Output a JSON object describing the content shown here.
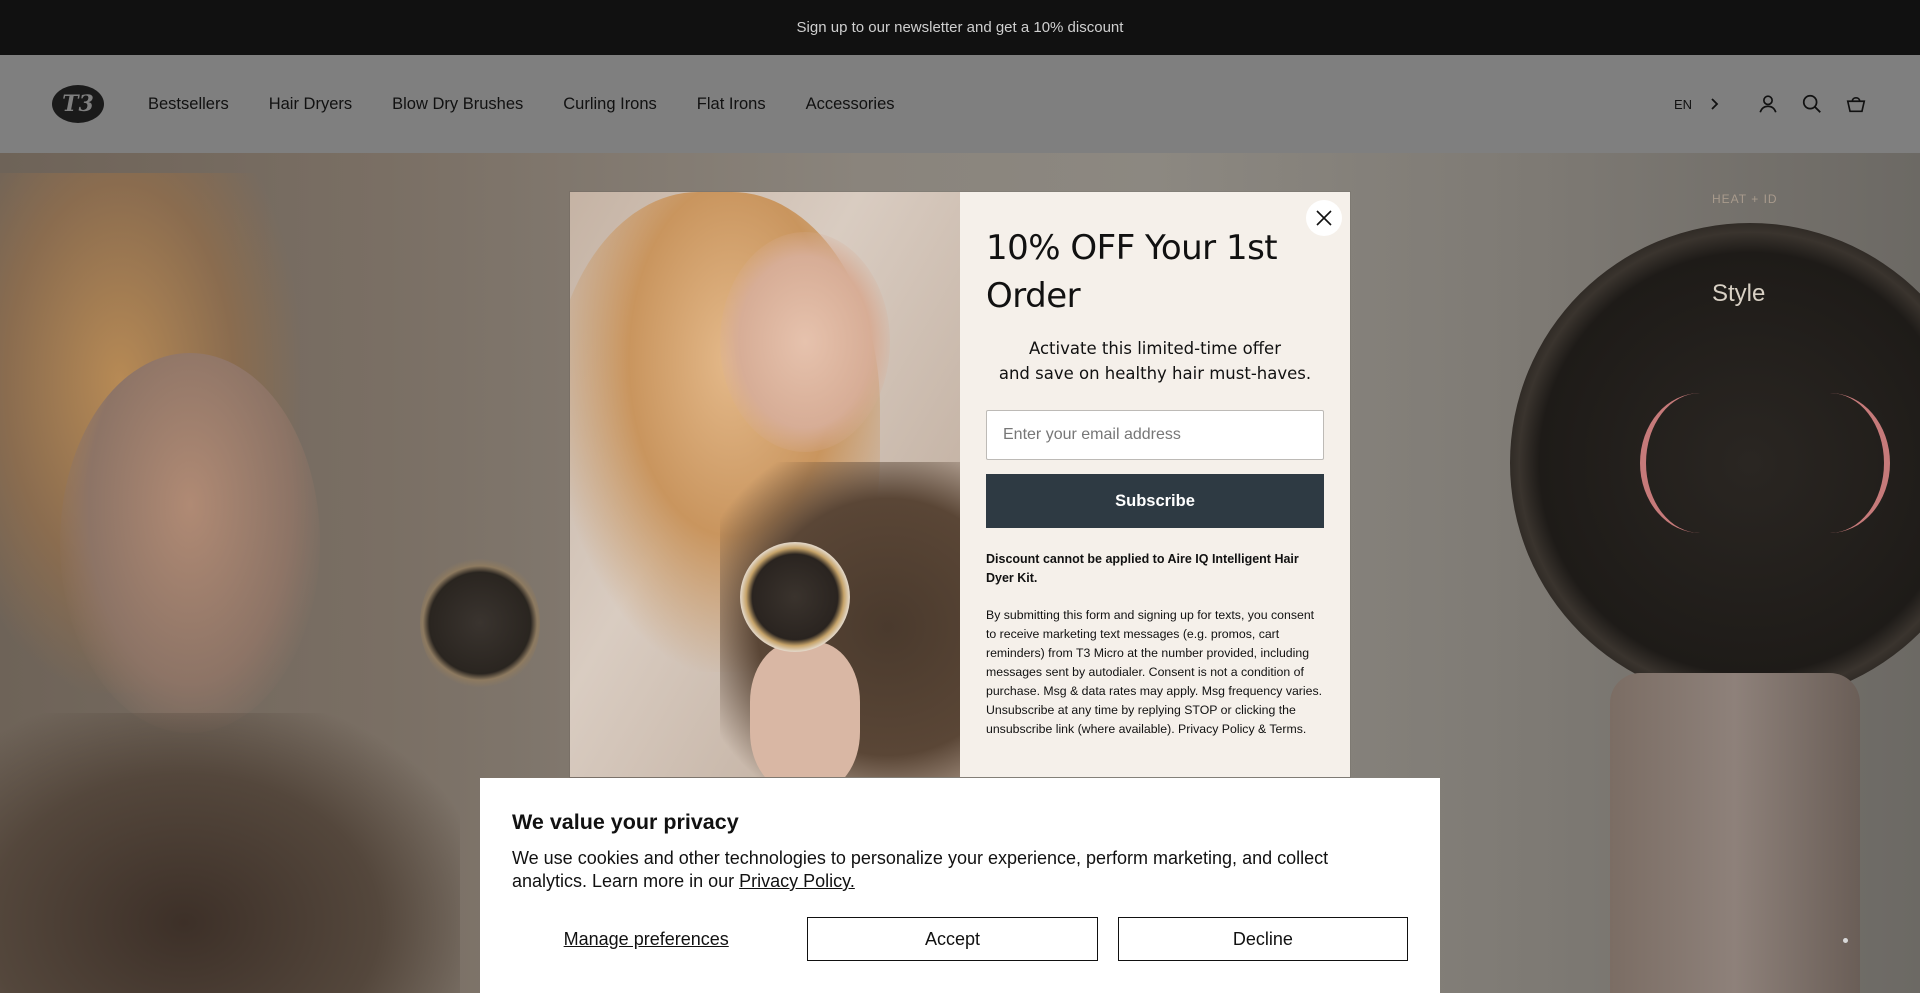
{
  "announcement": "Sign up to our newsletter and get a 10% discount",
  "header": {
    "logo": "T3",
    "nav": [
      "Bestsellers",
      "Hair Dryers",
      "Blow Dry Brushes",
      "Curling Irons",
      "Flat Irons",
      "Accessories"
    ],
    "language": "EN",
    "icons": [
      "chevron-right-icon",
      "account-icon",
      "search-icon",
      "cart-icon"
    ]
  },
  "hero": {
    "dial_label": "Style",
    "dial_top_label": "HEAT + ID"
  },
  "popup": {
    "title": "10% OFF Your 1st Order",
    "subtitle_line1": "Activate this limited-time offer",
    "subtitle_line2": "and save on healthy hair must-haves.",
    "email_placeholder": "Enter your email address",
    "subscribe_label": "Subscribe",
    "discount_note": "Discount cannot be applied to Aire IQ Intelligent Hair Dyer Kit.",
    "legal": "By submitting this form and signing up for texts, you consent to receive marketing text messages (e.g. promos, cart reminders) from T3 Micro at the number provided, including messages sent by autodialer. Consent is not a condition of purchase. Msg & data rates may apply. Msg frequency varies. Unsubscribe at any time by replying STOP or clicking the unsubscribe link (where available). Privacy Policy & Terms.",
    "close_icon": "close-icon",
    "button_color": "#2e3a43"
  },
  "cookie": {
    "title": "We value your privacy",
    "text": "We use cookies and other technologies to personalize your experience, perform marketing, and collect analytics. Learn more in our",
    "policy_link": "Privacy Policy.",
    "manage": "Manage preferences",
    "accept": "Accept",
    "decline": "Decline"
  }
}
